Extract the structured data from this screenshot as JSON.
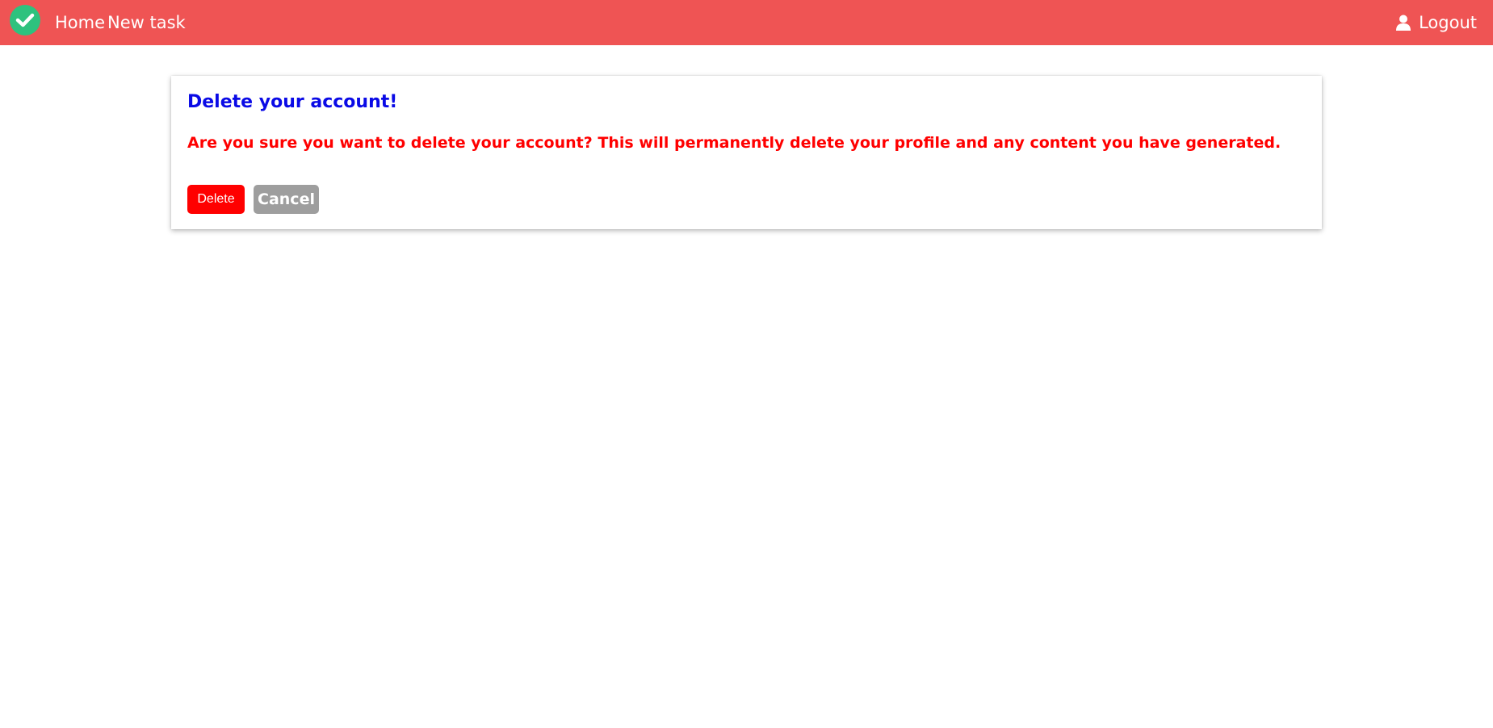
{
  "navbar": {
    "background": "#ef5454",
    "logo_icon": "check-circle-icon",
    "logo_color": "#2ec27e",
    "home_label": "Home",
    "new_task_label": "New task",
    "logout_label": "Logout",
    "logout_icon": "user-icon"
  },
  "dialog": {
    "title": "Delete your account!",
    "title_color": "#0a0ae6",
    "message": "Are you sure you want to delete your account? This will permanently delete your profile and any content you have generated.",
    "message_color": "#ff0000",
    "delete_label": "Delete",
    "delete_color": "#ff0000",
    "cancel_label": "Cancel",
    "cancel_color": "#9e9e9e"
  }
}
